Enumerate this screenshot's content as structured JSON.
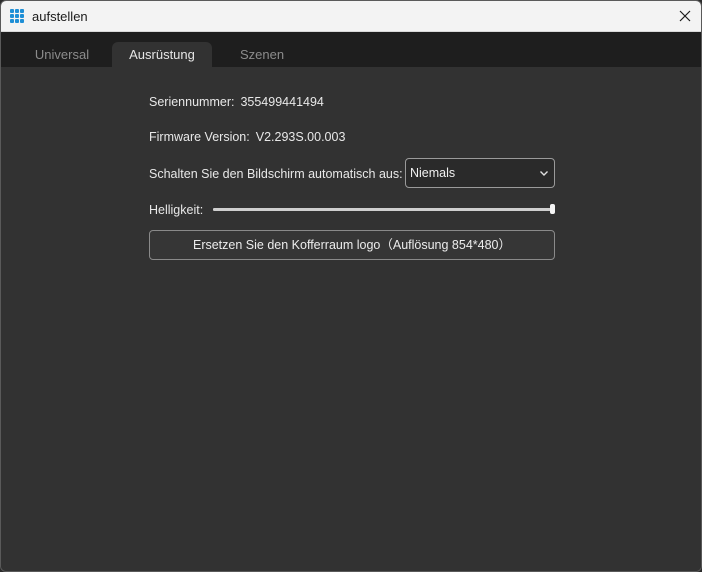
{
  "window": {
    "title": "aufstellen",
    "icon": "app-grid-icon",
    "close_icon": "close-icon"
  },
  "tabs": [
    {
      "label": "Universal",
      "active": false
    },
    {
      "label": "Ausrüstung",
      "active": true
    },
    {
      "label": "Szenen",
      "active": false
    }
  ],
  "device": {
    "serial_label": "Seriennummer:",
    "serial_value": "355499441494",
    "firmware_label": "Firmware Version:",
    "firmware_value": "V2.293S.00.003",
    "screen_off_label": "Schalten Sie den Bildschirm automatisch aus:",
    "screen_off_value": "Niemals",
    "brightness_label": "Helligkeit:",
    "brightness_level": 1.0,
    "replace_logo_label": "Ersetzen Sie den Kofferraum logo（Auflösung 854*480）"
  },
  "colors": {
    "titlebar_bg": "#f3f3f3",
    "tabbar_bg": "#1e1e1e",
    "content_bg": "#323232",
    "accent_icon": "#1e8fd6"
  }
}
